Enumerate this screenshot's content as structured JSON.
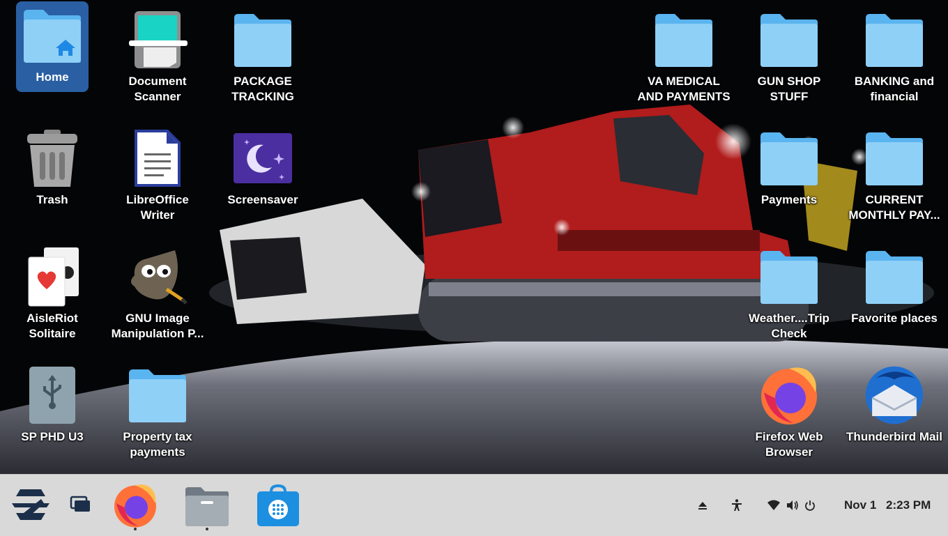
{
  "desktop": {
    "icons": {
      "home": "Home",
      "document_scanner": "Document Scanner",
      "package_tracking": "PACKAGE TRACKING",
      "va_medical": "VA MEDICAL AND PAYMENTS",
      "gun_shop": "GUN SHOP STUFF",
      "banking": "BANKING and financial",
      "trash": "Trash",
      "libreoffice_writer": "LibreOffice Writer",
      "screensaver": "Screensaver",
      "payments": "Payments",
      "current_monthly": "CURRENT MONTHLY PAY...",
      "aisleriot": "AisleRiot Solitaire",
      "gimp": "GNU Image Manipulation P...",
      "weather": "Weather....Trip Check",
      "favorite_places": "Favorite places",
      "sp_phd": "SP PHD U3",
      "property_tax": "Property tax payments",
      "firefox": "Firefox Web Browser",
      "thunderbird": "Thunderbird Mail"
    }
  },
  "taskbar": {
    "date": "Nov 1",
    "time": "2:23 PM"
  },
  "colors": {
    "folder": "#8fd0f7",
    "folder_tab": "#5ab4ef",
    "taskbar": "#d9d9d9",
    "selected": "#2a5fa3"
  }
}
